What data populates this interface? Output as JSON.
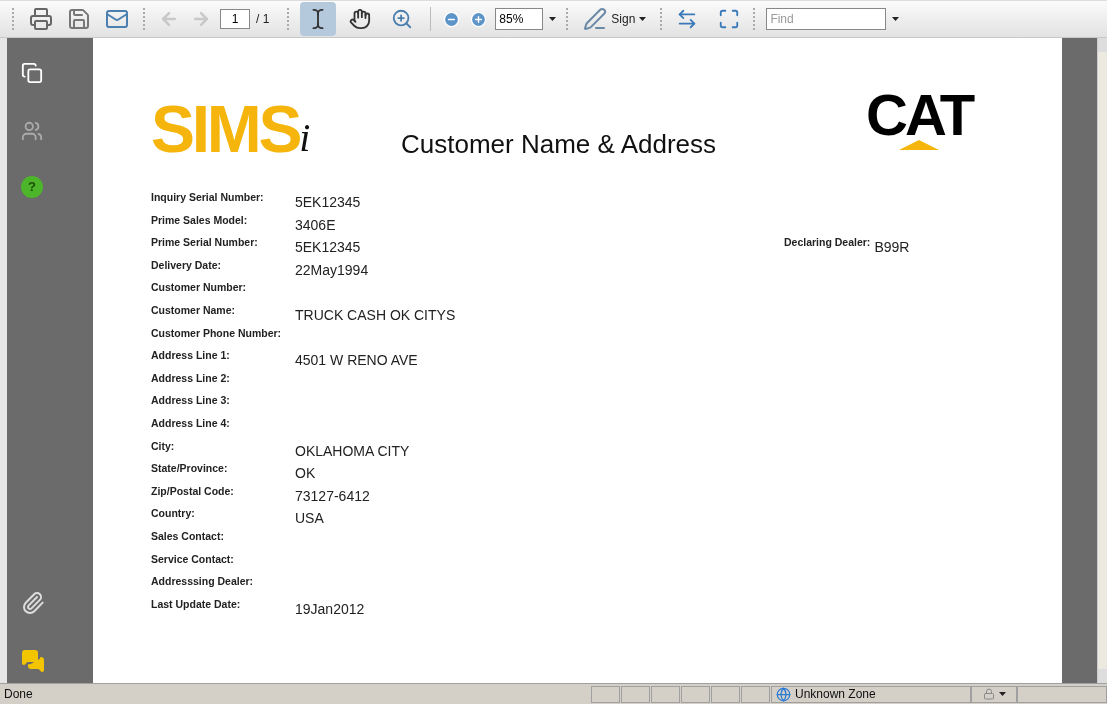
{
  "toolbar": {
    "nav": [
      {
        "kind": "previous",
        "disabled": true
      },
      {
        "kind": "next",
        "disabled": true
      }
    ],
    "page_input": "1",
    "page_count": "/ 1",
    "tools": [
      {
        "kind": "select",
        "selected": true
      },
      {
        "kind": "hand",
        "selected": false
      },
      {
        "kind": "marquee-zoom",
        "selected": false
      }
    ],
    "zoom": "85%",
    "sign_label": "Sign",
    "find_placeholder": "Find"
  },
  "sidebar": {
    "help_label": "?"
  },
  "document": {
    "logo_left": {
      "text": "SIMS",
      "suffix": "i"
    },
    "title": "Customer Name & Address",
    "logo_right": "CAT",
    "fields": [
      {
        "label": "Inquiry Serial Number:",
        "value": "5EK12345"
      },
      {
        "label": "Prime Sales Model:",
        "value": "3406E"
      },
      {
        "label": "Prime Serial Number:",
        "value": "5EK12345",
        "side": {
          "label": "Declaring Dealer:",
          "value": "B99R"
        }
      },
      {
        "label": "Delivery Date:",
        "value": "22May1994"
      },
      {
        "label": "Customer Number:"
      },
      {
        "label": "Customer Name:",
        "value": "TRUCK CASH OK CITYS"
      },
      {
        "label": "Customer Phone Number:"
      },
      {
        "label": "Address Line 1:",
        "value": "4501 W RENO AVE"
      },
      {
        "label": "Address Line 2:"
      },
      {
        "label": "Address Line 3:"
      },
      {
        "label": "Address Line 4:"
      },
      {
        "label": "City:",
        "value": "OKLAHOMA CITY"
      },
      {
        "label": "State/Province:",
        "value": "OK"
      },
      {
        "label": "Zip/Postal Code:",
        "value": "73127-6412"
      },
      {
        "label": "Country:",
        "value": "USA"
      },
      {
        "label": "Sales Contact:"
      },
      {
        "label": "Service Contact:"
      },
      {
        "label": "Addresssing Dealer:"
      },
      {
        "label": "Last Update Date:",
        "value": "19Jan2012"
      }
    ]
  },
  "status_bar": {
    "text": "Done",
    "zone": "Unknown Zone"
  }
}
